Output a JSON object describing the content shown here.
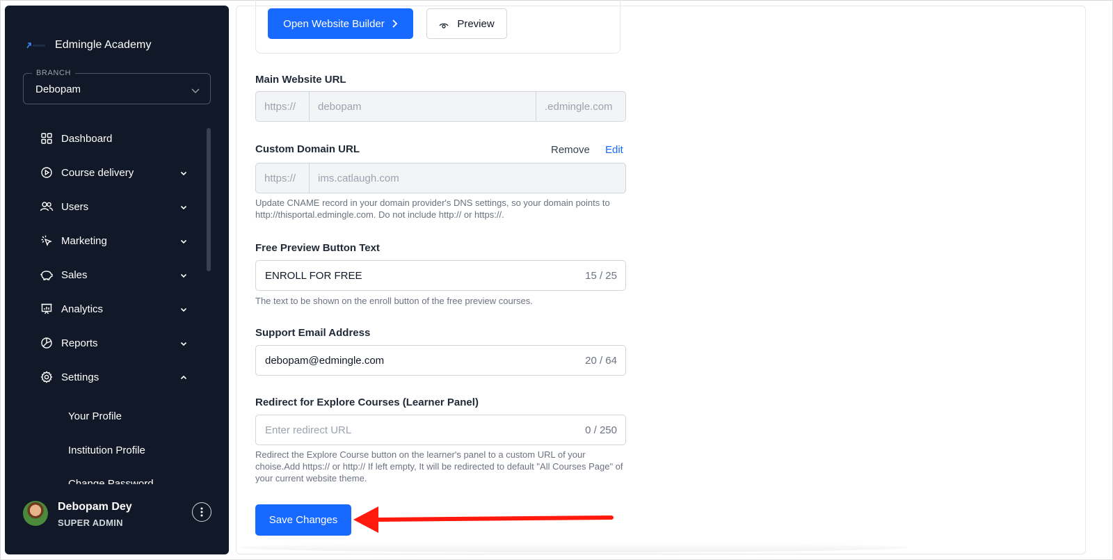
{
  "sidebar": {
    "brand": {
      "name": "Edmingle Academy"
    },
    "branch": {
      "legend": "BRANCH",
      "value": "Debopam"
    },
    "nav": [
      {
        "label": "Dashboard",
        "icon": "grid-icon"
      },
      {
        "label": "Course delivery",
        "icon": "play-circle-icon"
      },
      {
        "label": "Users",
        "icon": "users-icon"
      },
      {
        "label": "Marketing",
        "icon": "cursor-click-icon"
      },
      {
        "label": "Sales",
        "icon": "piggy-bank-icon"
      },
      {
        "label": "Analytics",
        "icon": "presentation-chart-icon"
      },
      {
        "label": "Reports",
        "icon": "pie-chart-icon"
      },
      {
        "label": "Settings",
        "icon": "gear-icon"
      }
    ],
    "settings_sub": [
      {
        "label": "Your Profile"
      },
      {
        "label": "Institution Profile"
      },
      {
        "label": "Change Password"
      }
    ],
    "user": {
      "name": "Debopam Dey",
      "role": "SUPER ADMIN"
    }
  },
  "main": {
    "builder": {
      "open_label": "Open Website Builder",
      "preview_label": "Preview"
    },
    "main_url": {
      "label": "Main Website URL",
      "prefix": "https://",
      "value": "debopam",
      "suffix": ".edmingle.com"
    },
    "custom_domain": {
      "label": "Custom Domain URL",
      "remove_label": "Remove",
      "edit_label": "Edit",
      "prefix": "https://",
      "value": "ims.catlaugh.com",
      "help": "Update CNAME record in your domain provider's DNS settings, so your domain points to http://thisportal.edmingle.com. Do not include http:// or https://."
    },
    "free_preview": {
      "label": "Free Preview Button Text",
      "value": "ENROLL FOR FREE",
      "count": "15 / 25",
      "help": "The text to be shown on the enroll button of the free preview courses."
    },
    "support_email": {
      "label": "Support Email Address",
      "value": "debopam@edmingle.com",
      "count": "20 / 64"
    },
    "redirect": {
      "label": "Redirect for Explore Courses (Learner Panel)",
      "placeholder": "Enter redirect URL",
      "count": "0 / 250",
      "help": "Redirect the Explore Course button on the learner's panel to a custom URL of your choise.Add https:// or http:// If left empty, It will be redirected to default \"All Courses Page\" of your current website theme."
    },
    "save_label": "Save Changes"
  },
  "colors": {
    "sidebar_bg": "#111827",
    "primary": "#1769ff",
    "annotation_arrow": "#ff1a0d"
  }
}
